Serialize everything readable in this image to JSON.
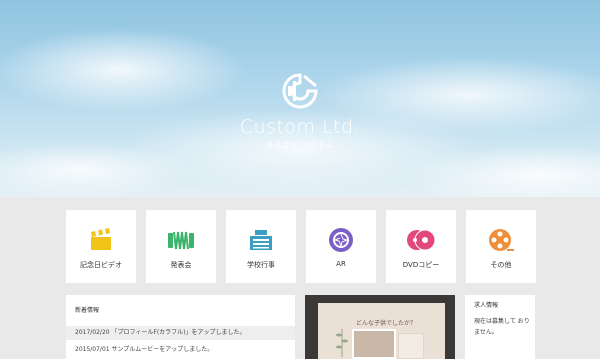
{
  "hero": {
    "brand_name": "Custom Ltd.",
    "brand_sub": "株式会社 カスタム",
    "logo_icon": "film-reel-logo-icon"
  },
  "tiles": [
    {
      "label": "記念日ビデオ",
      "icon": "clapperboard-icon",
      "color": "#f2c418"
    },
    {
      "label": "発表会",
      "icon": "accordion-icon",
      "color": "#3bb36b"
    },
    {
      "label": "学校行事",
      "icon": "school-building-icon",
      "color": "#3b9fc2"
    },
    {
      "label": "AR",
      "icon": "aperture-icon",
      "color": "#7b5fc7"
    },
    {
      "label": "DVDコピー",
      "icon": "dvd-discs-icon",
      "color": "#e2487a"
    },
    {
      "label": "その他",
      "icon": "film-reel-icon",
      "color": "#ef8f3c"
    }
  ],
  "news": {
    "title": "新着情報",
    "items": [
      "2017/02/20 「プロフィールF(カラフル)」をアップしました。",
      "2015/07/01 サンプルムービーをアップしました。"
    ]
  },
  "video": {
    "caption": "どんな子供でしたか？"
  },
  "recruit": {
    "title": "求人情報",
    "text": "現在は募集して おりません。"
  }
}
